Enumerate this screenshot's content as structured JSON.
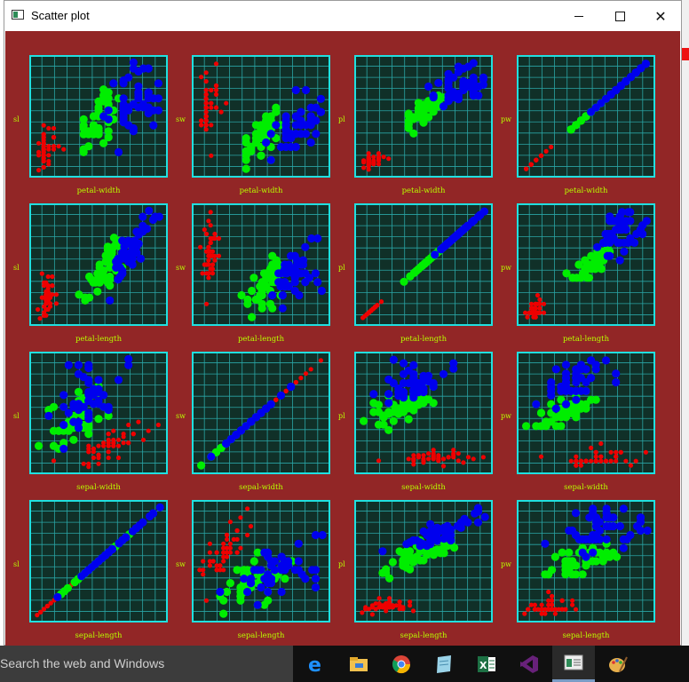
{
  "window": {
    "title": "Scatter plot"
  },
  "taskbar": {
    "search_placeholder": "Search the web and Windows",
    "apps": [
      {
        "name": "edge-icon",
        "color": "#1e90ff"
      },
      {
        "name": "file-explorer-icon",
        "color": "#f2c14e"
      },
      {
        "name": "chrome-icon",
        "color": "#34a853"
      },
      {
        "name": "notepad-icon",
        "color": "#9ad3e8"
      },
      {
        "name": "excel-icon",
        "color": "#1d7044"
      },
      {
        "name": "visual-studio-icon",
        "color": "#68217a"
      },
      {
        "name": "window-app-icon",
        "color": "#dddddd"
      },
      {
        "name": "paint-icon",
        "color": "#e8b04c"
      }
    ]
  },
  "colors": {
    "background": "#922626",
    "plot_background": "#103028",
    "frame": "#20e0e0",
    "grid": "#2aa5a5",
    "label": "#b8ff00",
    "setosa": "#ee0000",
    "versicolor": "#00ee00",
    "virginica": "#0000ee"
  },
  "chart_data": {
    "type": "scatter",
    "description": "scatter matrix of iris data; rows share x variable, columns share y variable",
    "row_x_labels": [
      "petal-width",
      "petal-length",
      "sepal-width",
      "sepal-length"
    ],
    "col_y_labels": [
      "sl",
      "sw",
      "pl",
      "pw"
    ],
    "var_keys": [
      "pw",
      "pl",
      "sw",
      "sl"
    ],
    "col_var_keys": [
      "sl",
      "sw",
      "pl",
      "pw"
    ],
    "ranges": {
      "sl": [
        4.2,
        8.0
      ],
      "sw": [
        1.9,
        4.5
      ],
      "pl": [
        0.8,
        7.1
      ],
      "pw": [
        0.0,
        2.6
      ]
    },
    "grid_divisions": 11,
    "grid": true,
    "series": [
      {
        "color_key": "setosa",
        "points": [
          [
            5.1,
            3.5,
            1.4,
            0.2
          ],
          [
            4.9,
            3.0,
            1.4,
            0.2
          ],
          [
            4.7,
            3.2,
            1.3,
            0.2
          ],
          [
            4.6,
            3.1,
            1.5,
            0.2
          ],
          [
            5.0,
            3.6,
            1.4,
            0.2
          ],
          [
            5.4,
            3.9,
            1.7,
            0.4
          ],
          [
            4.6,
            3.4,
            1.4,
            0.3
          ],
          [
            5.0,
            3.4,
            1.5,
            0.2
          ],
          [
            4.4,
            2.9,
            1.4,
            0.2
          ],
          [
            4.9,
            3.1,
            1.5,
            0.1
          ],
          [
            5.4,
            3.7,
            1.5,
            0.2
          ],
          [
            4.8,
            3.4,
            1.6,
            0.2
          ],
          [
            4.8,
            3.0,
            1.4,
            0.1
          ],
          [
            4.3,
            3.0,
            1.1,
            0.1
          ],
          [
            5.8,
            4.0,
            1.2,
            0.2
          ],
          [
            5.7,
            4.4,
            1.5,
            0.4
          ],
          [
            5.4,
            3.9,
            1.3,
            0.4
          ],
          [
            5.1,
            3.5,
            1.4,
            0.3
          ],
          [
            5.7,
            3.8,
            1.7,
            0.3
          ],
          [
            5.1,
            3.8,
            1.5,
            0.3
          ],
          [
            5.4,
            3.4,
            1.7,
            0.2
          ],
          [
            5.1,
            3.7,
            1.5,
            0.4
          ],
          [
            4.6,
            3.6,
            1.0,
            0.2
          ],
          [
            5.1,
            3.3,
            1.7,
            0.5
          ],
          [
            4.8,
            3.4,
            1.9,
            0.2
          ],
          [
            5.0,
            3.0,
            1.6,
            0.2
          ],
          [
            5.0,
            3.4,
            1.6,
            0.4
          ],
          [
            5.2,
            3.5,
            1.5,
            0.2
          ],
          [
            5.2,
            3.4,
            1.4,
            0.2
          ],
          [
            4.7,
            3.2,
            1.6,
            0.2
          ],
          [
            4.8,
            3.1,
            1.6,
            0.2
          ],
          [
            5.4,
            3.4,
            1.5,
            0.4
          ],
          [
            5.2,
            4.1,
            1.5,
            0.1
          ],
          [
            5.5,
            4.2,
            1.4,
            0.2
          ],
          [
            4.9,
            3.1,
            1.5,
            0.2
          ],
          [
            5.0,
            3.2,
            1.2,
            0.2
          ],
          [
            5.5,
            3.5,
            1.3,
            0.2
          ],
          [
            4.4,
            3.0,
            1.3,
            0.2
          ],
          [
            5.1,
            3.4,
            1.5,
            0.2
          ],
          [
            5.0,
            3.5,
            1.3,
            0.3
          ],
          [
            4.5,
            2.3,
            1.3,
            0.3
          ],
          [
            4.4,
            3.2,
            1.3,
            0.2
          ],
          [
            5.0,
            3.5,
            1.6,
            0.6
          ],
          [
            5.1,
            3.8,
            1.9,
            0.4
          ],
          [
            4.8,
            3.0,
            1.4,
            0.3
          ],
          [
            5.1,
            3.8,
            1.6,
            0.2
          ],
          [
            4.6,
            3.2,
            1.4,
            0.2
          ],
          [
            5.3,
            3.7,
            1.5,
            0.2
          ],
          [
            5.0,
            3.3,
            1.4,
            0.2
          ],
          [
            5.2,
            3.6,
            1.4,
            0.2
          ]
        ]
      },
      {
        "color_key": "versicolor",
        "points": [
          [
            7.0,
            3.2,
            4.7,
            1.4
          ],
          [
            6.4,
            3.2,
            4.5,
            1.5
          ],
          [
            6.9,
            3.1,
            4.9,
            1.5
          ],
          [
            5.5,
            2.3,
            4.0,
            1.3
          ],
          [
            6.5,
            2.8,
            4.6,
            1.5
          ],
          [
            5.7,
            2.8,
            4.5,
            1.3
          ],
          [
            6.3,
            3.3,
            4.7,
            1.6
          ],
          [
            4.9,
            2.4,
            3.3,
            1.0
          ],
          [
            6.6,
            2.9,
            4.6,
            1.3
          ],
          [
            5.2,
            2.7,
            3.9,
            1.4
          ],
          [
            5.0,
            2.0,
            3.5,
            1.0
          ],
          [
            5.9,
            3.0,
            4.2,
            1.5
          ],
          [
            6.0,
            2.2,
            4.0,
            1.0
          ],
          [
            6.1,
            2.9,
            4.7,
            1.4
          ],
          [
            5.6,
            2.9,
            3.6,
            1.3
          ],
          [
            6.7,
            3.1,
            4.4,
            1.4
          ],
          [
            5.6,
            3.0,
            4.5,
            1.5
          ],
          [
            5.8,
            2.7,
            4.1,
            1.0
          ],
          [
            6.2,
            2.2,
            4.5,
            1.5
          ],
          [
            5.6,
            2.5,
            3.9,
            1.1
          ],
          [
            5.9,
            3.2,
            4.8,
            1.8
          ],
          [
            6.1,
            2.8,
            4.0,
            1.3
          ],
          [
            6.3,
            2.5,
            4.9,
            1.5
          ],
          [
            6.1,
            2.8,
            4.7,
            1.2
          ],
          [
            6.4,
            2.9,
            4.3,
            1.3
          ],
          [
            6.6,
            3.0,
            4.4,
            1.4
          ],
          [
            6.8,
            2.8,
            4.8,
            1.4
          ],
          [
            6.7,
            3.0,
            5.0,
            1.7
          ],
          [
            6.0,
            2.9,
            4.5,
            1.5
          ],
          [
            5.7,
            2.6,
            3.5,
            1.0
          ],
          [
            5.5,
            2.4,
            3.8,
            1.1
          ],
          [
            5.5,
            2.4,
            3.7,
            1.0
          ],
          [
            5.8,
            2.7,
            3.9,
            1.2
          ],
          [
            6.0,
            2.7,
            5.1,
            1.6
          ],
          [
            5.4,
            3.0,
            4.5,
            1.5
          ],
          [
            6.0,
            3.4,
            4.5,
            1.6
          ],
          [
            6.7,
            3.1,
            4.7,
            1.5
          ],
          [
            6.3,
            2.3,
            4.4,
            1.3
          ],
          [
            5.6,
            3.0,
            4.1,
            1.3
          ],
          [
            5.5,
            2.5,
            4.0,
            1.3
          ],
          [
            5.5,
            2.6,
            4.4,
            1.2
          ],
          [
            6.1,
            3.0,
            4.6,
            1.4
          ],
          [
            5.8,
            2.6,
            4.0,
            1.2
          ],
          [
            5.0,
            2.3,
            3.3,
            1.0
          ],
          [
            5.6,
            2.7,
            4.2,
            1.3
          ],
          [
            5.7,
            3.0,
            4.2,
            1.2
          ],
          [
            5.7,
            2.9,
            4.2,
            1.3
          ],
          [
            6.2,
            2.9,
            4.3,
            1.3
          ],
          [
            5.1,
            2.5,
            3.0,
            1.1
          ],
          [
            5.7,
            2.8,
            4.1,
            1.3
          ]
        ]
      },
      {
        "color_key": "virginica",
        "points": [
          [
            6.3,
            3.3,
            6.0,
            2.5
          ],
          [
            5.8,
            2.7,
            5.1,
            1.9
          ],
          [
            7.1,
            3.0,
            5.9,
            2.1
          ],
          [
            6.3,
            2.9,
            5.6,
            1.8
          ],
          [
            6.5,
            3.0,
            5.8,
            2.2
          ],
          [
            7.6,
            3.0,
            6.6,
            2.1
          ],
          [
            4.9,
            2.5,
            4.5,
            1.7
          ],
          [
            7.3,
            2.9,
            6.3,
            1.8
          ],
          [
            6.7,
            2.5,
            5.8,
            1.8
          ],
          [
            7.2,
            3.6,
            6.1,
            2.5
          ],
          [
            6.5,
            3.2,
            5.1,
            2.0
          ],
          [
            6.4,
            2.7,
            5.3,
            1.9
          ],
          [
            6.8,
            3.0,
            5.5,
            2.1
          ],
          [
            5.7,
            2.5,
            5.0,
            2.0
          ],
          [
            5.8,
            2.8,
            5.1,
            2.4
          ],
          [
            6.4,
            3.2,
            5.3,
            2.3
          ],
          [
            6.5,
            3.0,
            5.5,
            1.8
          ],
          [
            7.7,
            3.8,
            6.7,
            2.2
          ],
          [
            7.7,
            2.6,
            6.9,
            2.3
          ],
          [
            6.0,
            2.2,
            5.0,
            1.5
          ],
          [
            6.9,
            3.2,
            5.7,
            2.3
          ],
          [
            5.6,
            2.8,
            4.9,
            2.0
          ],
          [
            7.7,
            2.8,
            6.7,
            2.0
          ],
          [
            6.3,
            2.7,
            4.9,
            1.8
          ],
          [
            6.7,
            3.3,
            5.7,
            2.1
          ],
          [
            7.2,
            3.2,
            6.0,
            1.8
          ],
          [
            6.2,
            2.8,
            4.8,
            1.8
          ],
          [
            6.1,
            3.0,
            4.9,
            1.8
          ],
          [
            6.4,
            2.8,
            5.6,
            2.1
          ],
          [
            7.2,
            3.0,
            5.8,
            1.6
          ],
          [
            7.4,
            2.8,
            6.1,
            1.9
          ],
          [
            7.9,
            3.8,
            6.4,
            2.0
          ],
          [
            6.4,
            2.8,
            5.6,
            2.2
          ],
          [
            6.3,
            2.8,
            5.1,
            1.5
          ],
          [
            6.1,
            2.6,
            5.6,
            1.4
          ],
          [
            7.7,
            3.0,
            6.1,
            2.3
          ],
          [
            6.3,
            3.4,
            5.6,
            2.4
          ],
          [
            6.4,
            3.1,
            5.5,
            1.8
          ],
          [
            6.0,
            3.0,
            4.8,
            1.8
          ],
          [
            6.9,
            3.1,
            5.4,
            2.1
          ],
          [
            6.7,
            3.1,
            5.6,
            2.4
          ],
          [
            6.9,
            3.1,
            5.1,
            2.3
          ],
          [
            5.8,
            2.7,
            5.1,
            1.9
          ],
          [
            6.8,
            3.2,
            5.9,
            2.3
          ],
          [
            6.7,
            3.3,
            5.7,
            2.5
          ],
          [
            6.7,
            3.0,
            5.2,
            2.3
          ],
          [
            6.3,
            2.5,
            5.0,
            1.9
          ],
          [
            6.5,
            3.0,
            5.2,
            2.0
          ],
          [
            6.2,
            3.4,
            5.4,
            2.3
          ],
          [
            5.9,
            3.0,
            5.1,
            1.8
          ]
        ]
      }
    ]
  }
}
